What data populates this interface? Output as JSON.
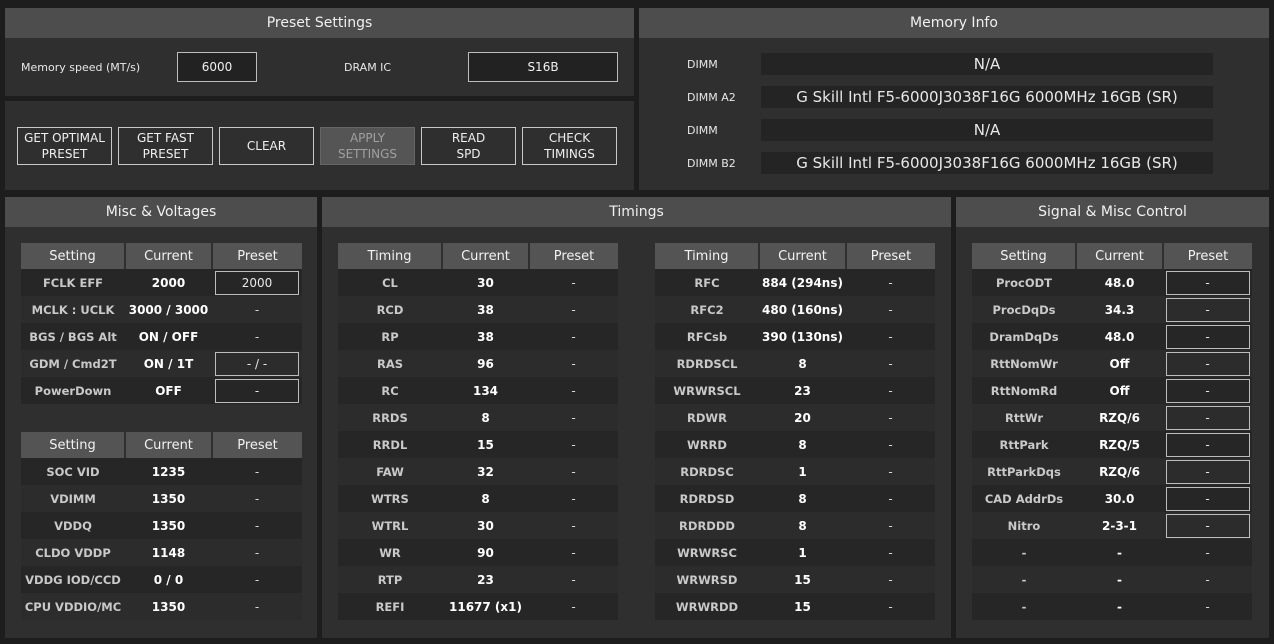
{
  "preset_settings": {
    "title": "Preset Settings",
    "memory_speed_label": "Memory speed (MT/s)",
    "memory_speed_value": "6000",
    "dram_ic_label": "DRAM IC",
    "dram_ic_value": "S16B"
  },
  "buttons": {
    "get_optimal": "GET OPTIMAL\nPRESET",
    "get_fast": "GET FAST\nPRESET",
    "clear": "CLEAR",
    "apply": "APPLY\nSETTINGS",
    "read_spd": "READ\nSPD",
    "check_timings": "CHECK\nTIMINGS"
  },
  "memory_info": {
    "title": "Memory Info",
    "slots": [
      {
        "label": "DIMM",
        "value": "N/A"
      },
      {
        "label": "DIMM A2",
        "value": "G Skill Intl F5-6000J3038F16G 6000MHz 16GB (SR)"
      },
      {
        "label": "DIMM",
        "value": "N/A"
      },
      {
        "label": "DIMM B2",
        "value": "G Skill Intl F5-6000J3038F16G 6000MHz 16GB (SR)"
      }
    ]
  },
  "misc": {
    "title": "Misc & Voltages",
    "headers": [
      "Setting",
      "Current",
      "Preset"
    ],
    "rows1": [
      {
        "setting": "FCLK EFF",
        "current": "2000",
        "preset": "2000",
        "boxed": true
      },
      {
        "setting": "MCLK : UCLK",
        "current": "3000  /  3000",
        "preset": "-",
        "boxed": false
      },
      {
        "setting": "BGS / BGS Alt",
        "current": "ON / OFF",
        "preset": "-",
        "boxed": false
      },
      {
        "setting": "GDM / Cmd2T",
        "current": "ON / 1T",
        "preset": "- / -",
        "boxed": true
      },
      {
        "setting": "PowerDown",
        "current": "OFF",
        "preset": "-",
        "boxed": true
      }
    ],
    "rows2": [
      {
        "setting": "SOC VID",
        "current": "1235",
        "preset": "-"
      },
      {
        "setting": "VDIMM",
        "current": "1350",
        "preset": "-"
      },
      {
        "setting": "VDDQ",
        "current": "1350",
        "preset": "-"
      },
      {
        "setting": "CLDO VDDP",
        "current": "1148",
        "preset": "-"
      },
      {
        "setting": "VDDG IOD/CCD",
        "current": "0 / 0",
        "preset": "-"
      },
      {
        "setting": "CPU VDDIO/MC",
        "current": "1350",
        "preset": "-"
      }
    ]
  },
  "timings": {
    "title": "Timings",
    "headers": [
      "Timing",
      "Current",
      "Preset"
    ],
    "left": [
      {
        "t": "CL",
        "c": "30",
        "p": "-"
      },
      {
        "t": "RCD",
        "c": "38",
        "p": "-"
      },
      {
        "t": "RP",
        "c": "38",
        "p": "-"
      },
      {
        "t": "RAS",
        "c": "96",
        "p": "-"
      },
      {
        "t": "RC",
        "c": "134",
        "p": "-"
      },
      {
        "t": "RRDS",
        "c": "8",
        "p": "-"
      },
      {
        "t": "RRDL",
        "c": "15",
        "p": "-"
      },
      {
        "t": "FAW",
        "c": "32",
        "p": "-"
      },
      {
        "t": "WTRS",
        "c": "8",
        "p": "-"
      },
      {
        "t": "WTRL",
        "c": "30",
        "p": "-"
      },
      {
        "t": "WR",
        "c": "90",
        "p": "-"
      },
      {
        "t": "RTP",
        "c": "23",
        "p": "-"
      },
      {
        "t": "REFI",
        "c": "11677 (x1)",
        "p": "-"
      }
    ],
    "right": [
      {
        "t": "RFC",
        "c": "884 (294ns)",
        "p": "-"
      },
      {
        "t": "RFC2",
        "c": "480 (160ns)",
        "p": "-"
      },
      {
        "t": "RFCsb",
        "c": "390 (130ns)",
        "p": "-"
      },
      {
        "t": "RDRDSCL",
        "c": "8",
        "p": "-"
      },
      {
        "t": "WRWRSCL",
        "c": "23",
        "p": "-"
      },
      {
        "t": "RDWR",
        "c": "20",
        "p": "-"
      },
      {
        "t": "WRRD",
        "c": "8",
        "p": "-"
      },
      {
        "t": "RDRDSC",
        "c": "1",
        "p": "-"
      },
      {
        "t": "RDRDSD",
        "c": "8",
        "p": "-"
      },
      {
        "t": "RDRDDD",
        "c": "8",
        "p": "-"
      },
      {
        "t": "WRWRSC",
        "c": "1",
        "p": "-"
      },
      {
        "t": "WRWRSD",
        "c": "15",
        "p": "-"
      },
      {
        "t": "WRWRDD",
        "c": "15",
        "p": "-"
      }
    ]
  },
  "signal": {
    "title": "Signal & Misc Control",
    "headers": [
      "Setting",
      "Current",
      "Preset"
    ],
    "rows": [
      {
        "setting": "ProcODT",
        "current": "48.0",
        "preset": "-",
        "boxed": true
      },
      {
        "setting": "ProcDqDs",
        "current": "34.3",
        "preset": "-",
        "boxed": true
      },
      {
        "setting": "DramDqDs",
        "current": "48.0",
        "preset": "-",
        "boxed": true
      },
      {
        "setting": "RttNomWr",
        "current": "Off",
        "preset": "-",
        "boxed": true
      },
      {
        "setting": "RttNomRd",
        "current": "Off",
        "preset": "-",
        "boxed": true
      },
      {
        "setting": "RttWr",
        "current": "RZQ/6",
        "preset": "-",
        "boxed": true
      },
      {
        "setting": "RttPark",
        "current": "RZQ/5",
        "preset": "-",
        "boxed": true
      },
      {
        "setting": "RttParkDqs",
        "current": "RZQ/6",
        "preset": "-",
        "boxed": true
      },
      {
        "setting": "CAD AddrDs",
        "current": "30.0",
        "preset": "-",
        "boxed": true
      },
      {
        "setting": "Nitro",
        "current": "2-3-1",
        "preset": "-",
        "boxed": true
      },
      {
        "setting": "-",
        "current": "-",
        "preset": "-",
        "boxed": false
      },
      {
        "setting": "-",
        "current": "-",
        "preset": "-",
        "boxed": false
      },
      {
        "setting": "-",
        "current": "-",
        "preset": "-",
        "boxed": false
      }
    ]
  }
}
